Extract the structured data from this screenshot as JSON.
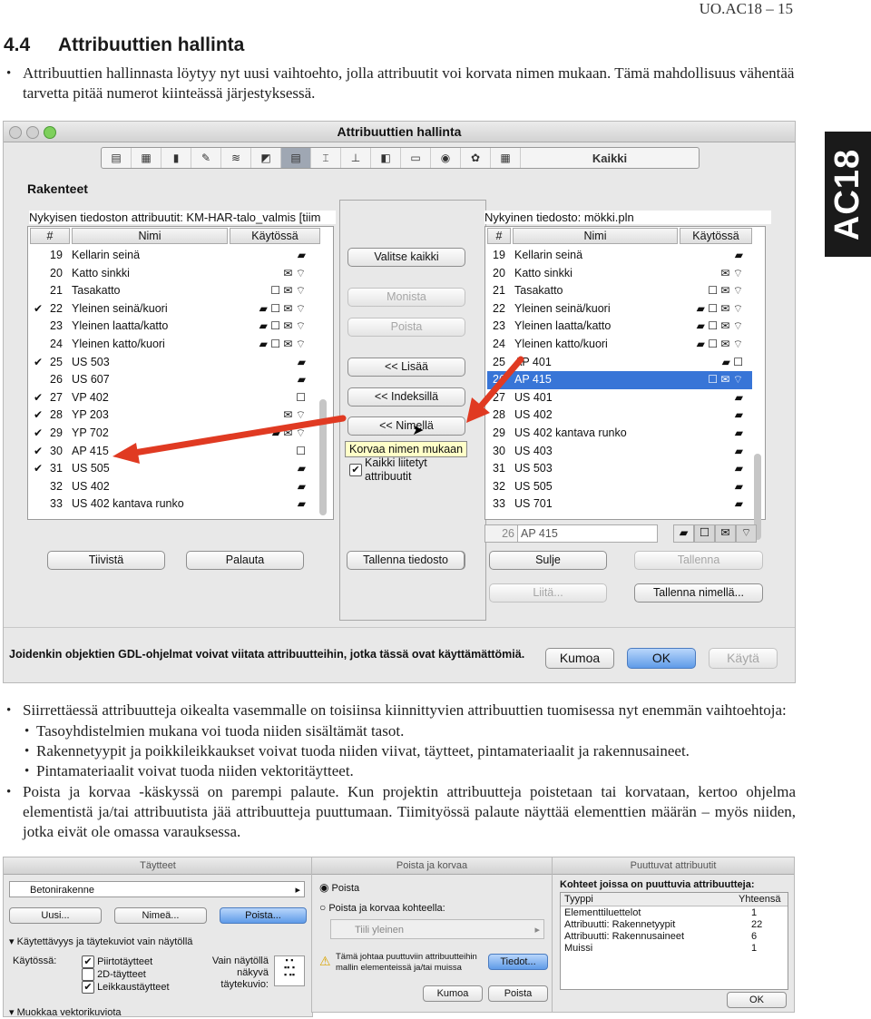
{
  "header": {
    "page_ref": "UO.AC18 – 15"
  },
  "section": {
    "number": "4.4",
    "title": "Attribuuttien hallinta"
  },
  "intro": "Attribuuttien hallinnasta löytyy nyt uusi vaihtoehto, jolla attribuutit voi korvata nimen mukaan. Tämä mahdollisuus vähentää tarvetta pitää numerot kiinteässä järjestyksessä.",
  "side_tab": "AC18",
  "dialog": {
    "title": "Attribuuttien hallinta",
    "toolbar_all": "Kaikki",
    "category": "Rakenteet",
    "left": {
      "heading": "Nykyisen tiedoston attribuutit: KM-HAR-talo_valmis  [tiim",
      "col_num": "#",
      "col_name": "Nimi",
      "col_used": "Käytössä",
      "rows": [
        {
          "chk": "",
          "no": "19",
          "name": "Kellarin seinä",
          "icons": "▰"
        },
        {
          "chk": "",
          "no": "20",
          "name": "Katto sinkki",
          "icons": "✉ ⌔"
        },
        {
          "chk": "",
          "no": "21",
          "name": "Tasakatto",
          "icons": "☐ ✉ ⌔"
        },
        {
          "chk": "✔",
          "no": "22",
          "name": "Yleinen seinä/kuori",
          "icons": "▰ ☐ ✉ ⌔"
        },
        {
          "chk": "",
          "no": "23",
          "name": "Yleinen laatta/katto",
          "icons": "▰ ☐ ✉ ⌔"
        },
        {
          "chk": "",
          "no": "24",
          "name": "Yleinen katto/kuori",
          "icons": "▰ ☐ ✉ ⌔"
        },
        {
          "chk": "✔",
          "no": "25",
          "name": "US 503",
          "icons": "▰"
        },
        {
          "chk": "",
          "no": "26",
          "name": "US 607",
          "icons": "▰"
        },
        {
          "chk": "✔",
          "no": "27",
          "name": "VP 402",
          "icons": "☐"
        },
        {
          "chk": "✔",
          "no": "28",
          "name": "YP 203",
          "icons": "✉ ⌔"
        },
        {
          "chk": "✔",
          "no": "29",
          "name": "YP 702",
          "icons": "▰ ✉ ⌔"
        },
        {
          "chk": "✔",
          "no": "30",
          "name": "AP 415",
          "icons": "☐"
        },
        {
          "chk": "✔",
          "no": "31",
          "name": "US 505",
          "icons": "▰"
        },
        {
          "chk": "",
          "no": "32",
          "name": "US 402",
          "icons": "▰"
        },
        {
          "chk": "",
          "no": "33",
          "name": "US 402 kantava runko",
          "icons": "▰"
        }
      ]
    },
    "middle": {
      "select_all": "Valitse kaikki",
      "duplicate": "Monista",
      "delete": "Poista",
      "add": "<< Lisää",
      "by_index": "<< Indeksillä",
      "by_name": "<< Nimellä",
      "tooltip": "Korvaa nimen mukaan",
      "all_linked_1": "Kaikki liitetyt",
      "all_linked_2": "attribuutit",
      "save_file": "Tallenna tiedosto"
    },
    "right": {
      "heading": "Nykyinen tiedosto: mökki.pln",
      "col_num": "#",
      "col_name": "Nimi",
      "col_used": "Käytössä",
      "rows": [
        {
          "no": "19",
          "name": "Kellarin seinä",
          "icons": "▰"
        },
        {
          "no": "20",
          "name": "Katto sinkki",
          "icons": "✉ ⌔"
        },
        {
          "no": "21",
          "name": "Tasakatto",
          "icons": "☐ ✉ ⌔"
        },
        {
          "no": "22",
          "name": "Yleinen seinä/kuori",
          "icons": "▰ ☐ ✉ ⌔"
        },
        {
          "no": "23",
          "name": "Yleinen laatta/katto",
          "icons": "▰ ☐ ✉ ⌔"
        },
        {
          "no": "24",
          "name": "Yleinen katto/kuori",
          "icons": "▰ ☐ ✉ ⌔"
        },
        {
          "no": "25",
          "name": "AP 401",
          "icons": "▰ ☐"
        },
        {
          "no": "26",
          "name": "AP 415",
          "icons": "☐ ✉ ⌔"
        },
        {
          "no": "27",
          "name": "US 401",
          "icons": "▰"
        },
        {
          "no": "28",
          "name": "US 402",
          "icons": "▰"
        },
        {
          "no": "29",
          "name": "US 402 kantava runko",
          "icons": "▰"
        },
        {
          "no": "30",
          "name": "US 403",
          "icons": "▰"
        },
        {
          "no": "31",
          "name": "US 503",
          "icons": "▰"
        },
        {
          "no": "32",
          "name": "US 505",
          "icons": "▰"
        },
        {
          "no": "33",
          "name": "US 701",
          "icons": "▰"
        }
      ],
      "edit_num": "26",
      "edit_name": "AP 415"
    },
    "compress": "Tiivistä",
    "restore": "Palauta",
    "close": "Sulje",
    "save": "Tallenna",
    "paste": "Liitä...",
    "save_as": "Tallenna nimellä...",
    "footer_note": "Joidenkin objektien GDL-ohjelmat voivat viitata attribuutteihin, jotka tässä ovat käyttämättömiä.",
    "undo": "Kumoa",
    "ok": "OK",
    "apply": "Käytä"
  },
  "bullets": [
    "Siirrettäessä attribuutteja oikealta vasemmalle on toisiinsa kiinnittyvien attribuuttien tuomisessa nyt enemmän vaihtoehtoja:",
    "Poista ja korvaa -käskyssä on parempi palaute. Kun projektin attribuutteja poistetaan tai korvataan, kertoo ohjelma elementistä ja/tai attribuutista jää attribuutteja puuttumaan. Tiimityössä palaute näyttää elementtien määrän – myös niiden, jotka eivät ole omassa varauksessa."
  ],
  "sub_bullets": [
    "Tasoyhdistelmien mukana voi tuoda niiden sisältämät tasot.",
    "Rakennetyypit ja poikkileikkaukset voivat tuoda niiden viivat, täytteet, pintamateriaalit ja rakennusaineet.",
    "Pintamateriaalit voivat tuoda niiden vektoritäytteet."
  ],
  "shot1": {
    "title": "Täytteet",
    "selected": "Betonirakenne",
    "new": "Uusi...",
    "name": "Nimeä...",
    "delete": "Poista...",
    "section": "Käytettävyys ja täytekuviot vain näytöllä",
    "usage": "Käytössä:",
    "opt1": "Piirtotäytteet",
    "opt2": "2D-täytteet",
    "opt3": "Leikkaustäytteet",
    "screen_only_1": "Vain näytöllä näkyvä",
    "screen_only_2": "täytekuvio:",
    "section2": "Muokkaa vektorikuviota"
  },
  "shot2": {
    "title": "Poista ja korvaa",
    "opt1": "Poista",
    "opt2": "Poista ja korvaa kohteella:",
    "replacement": "Tiili yleinen",
    "warning_1": "Tämä johtaa puuttuviin attribuutteihin",
    "warning_2": "mallin elementeissä ja/tai muissa",
    "details": "Tiedot...",
    "cancel": "Kumoa",
    "delete": "Poista"
  },
  "shot3": {
    "title": "Puuttuvat attribuutit",
    "heading": "Kohteet joissa on puuttuvia attribuutteja:",
    "col_type": "Tyyppi",
    "col_total": "Yhteensä",
    "rows": [
      {
        "type": "Elementtiluettelot",
        "total": "1"
      },
      {
        "type": "Attribuutti: Rakennetyypit",
        "total": "22"
      },
      {
        "type": "Attribuutti: Rakennusaineet",
        "total": "6"
      },
      {
        "type": "Muissi",
        "total": "1"
      }
    ],
    "ok": "OK"
  }
}
